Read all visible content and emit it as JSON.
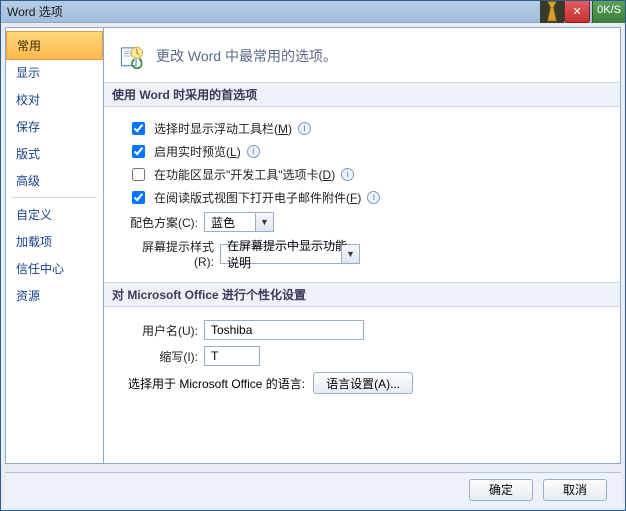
{
  "title": "Word 选项",
  "close_label": "✕",
  "oks_label": "0K/S",
  "sidebar": {
    "items": [
      {
        "label": "常用",
        "selected": true
      },
      {
        "label": "显示"
      },
      {
        "label": "校对"
      },
      {
        "label": "保存"
      },
      {
        "label": "版式"
      },
      {
        "label": "高级"
      },
      {
        "label": "divider"
      },
      {
        "label": "自定义"
      },
      {
        "label": "加载项"
      },
      {
        "label": "信任中心"
      },
      {
        "label": "资源"
      }
    ]
  },
  "header": {
    "text": "更改 Word 中最常用的选项。"
  },
  "section1": {
    "title": "使用 Word 时采用的首选项",
    "opt1": {
      "checked": true,
      "label": "选择时显示浮动工具栏",
      "hotkey": "M"
    },
    "opt2": {
      "checked": true,
      "label": "启用实时预览",
      "hotkey": "L"
    },
    "opt3": {
      "checked": false,
      "label": "在功能区显示\"开发工具\"选项卡",
      "hotkey": "D"
    },
    "opt4": {
      "checked": true,
      "label": "在阅读版式视图下打开电子邮件附件",
      "hotkey": "F"
    },
    "color_label": "配色方案(C):",
    "color_value": "蓝色",
    "tooltip_label": "屏幕提示样式(R):",
    "tooltip_value": "在屏幕提示中显示功能说明"
  },
  "section2": {
    "title": "对 Microsoft Office 进行个性化设置",
    "username_label": "用户名(U):",
    "username_value": "Toshiba",
    "initials_label": "缩写(I):",
    "initials_value": "T",
    "lang_text": "选择用于 Microsoft Office 的语言:",
    "lang_button": "语言设置(A)..."
  },
  "footer": {
    "ok": "确定",
    "cancel": "取消"
  }
}
